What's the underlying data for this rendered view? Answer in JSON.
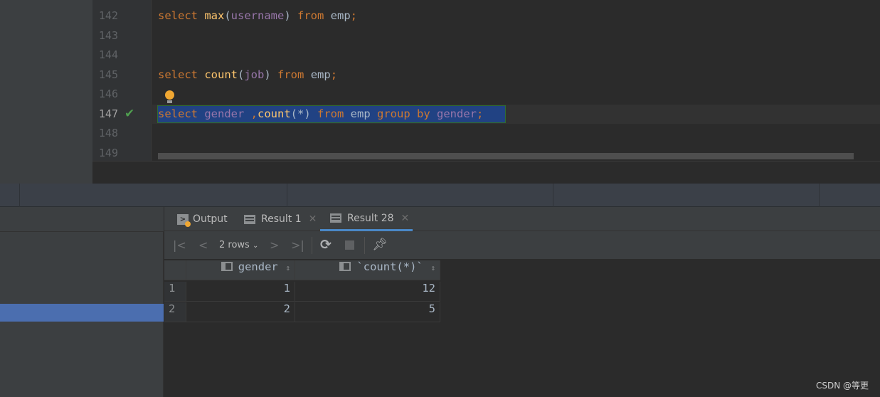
{
  "editor": {
    "lines": [
      {
        "num": "142",
        "tokens": [
          [
            "kw",
            "select "
          ],
          [
            "fn",
            "max"
          ],
          [
            "tb",
            "("
          ],
          [
            "id",
            "username"
          ],
          [
            "tb",
            ") "
          ],
          [
            "kw",
            "from "
          ],
          [
            "tb",
            "emp"
          ],
          [
            "kw",
            ";"
          ]
        ]
      },
      {
        "num": "143",
        "tokens": []
      },
      {
        "num": "144",
        "tokens": []
      },
      {
        "num": "145",
        "tokens": [
          [
            "kw",
            "select "
          ],
          [
            "fn",
            "count"
          ],
          [
            "tb",
            "("
          ],
          [
            "id",
            "job"
          ],
          [
            "tb",
            ") "
          ],
          [
            "kw",
            "from "
          ],
          [
            "tb",
            "emp"
          ],
          [
            "kw",
            ";"
          ]
        ]
      },
      {
        "num": "146",
        "tokens": []
      },
      {
        "num": "147",
        "tokens": [
          [
            "kw",
            "select "
          ],
          [
            "id",
            "gender "
          ],
          [
            "kw",
            ","
          ],
          [
            "fn",
            "count"
          ],
          [
            "tb",
            "(*) "
          ],
          [
            "kw",
            "from "
          ],
          [
            "tb",
            "emp "
          ],
          [
            "kw",
            "group by "
          ],
          [
            "id",
            "gender"
          ],
          [
            "kw",
            ";"
          ]
        ]
      },
      {
        "num": "148",
        "tokens": []
      },
      {
        "num": "149",
        "tokens": []
      }
    ],
    "current_line": "147"
  },
  "results": {
    "tabs": [
      {
        "label": "Output",
        "icon": "console-icon"
      },
      {
        "label": "Result 1",
        "icon": "table-icon"
      },
      {
        "label": "Result 28",
        "icon": "table-icon",
        "active": true
      }
    ],
    "rows_label": "2 rows",
    "columns": [
      "gender",
      "`count(*)`"
    ],
    "rows": [
      {
        "n": "1",
        "cells": [
          "1",
          "12"
        ]
      },
      {
        "n": "2",
        "cells": [
          "2",
          "5"
        ]
      }
    ]
  },
  "watermark": "CSDN @等更",
  "colors": {
    "accent": "#4a88c7",
    "selection": "#214283",
    "keyword": "#cc7832",
    "function": "#ffc66d",
    "identifier": "#9876aa"
  }
}
